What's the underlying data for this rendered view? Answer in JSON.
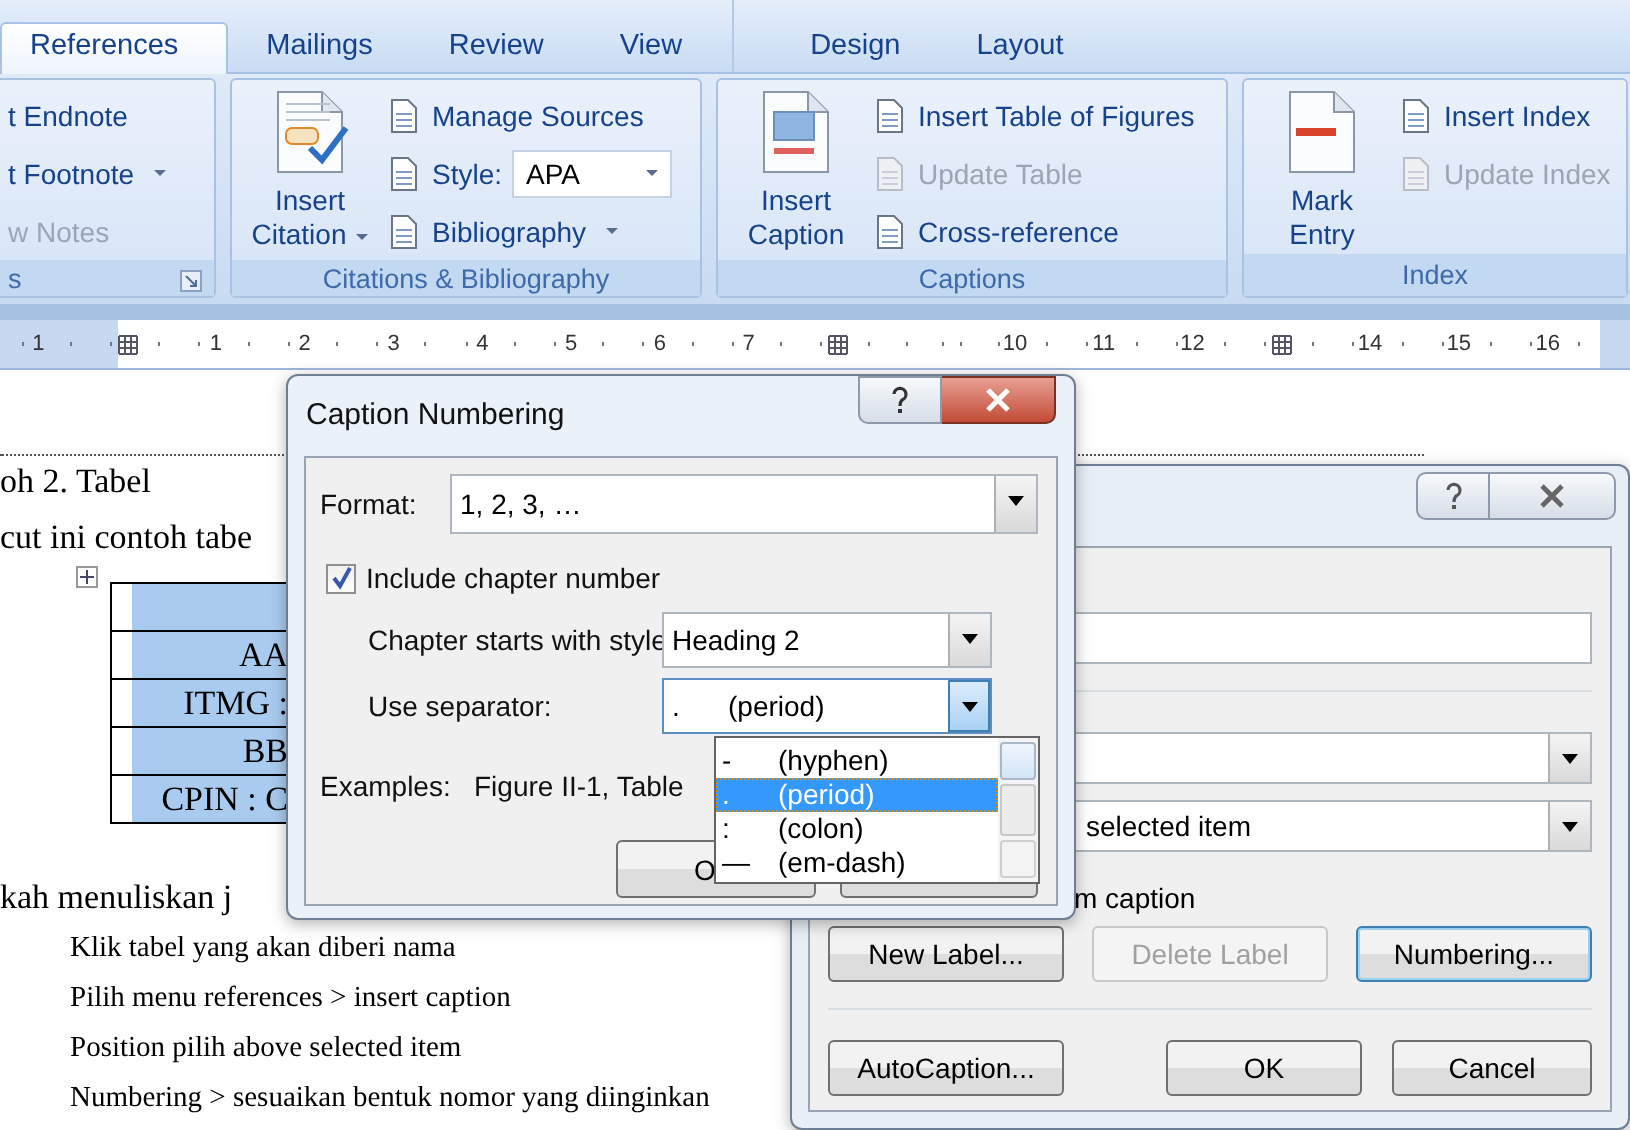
{
  "tabs": [
    {
      "label": "References",
      "selected": true
    },
    {
      "label": "Mailings",
      "selected": false
    },
    {
      "label": "Review",
      "selected": false
    },
    {
      "label": "View",
      "selected": false
    }
  ],
  "contextual_tabs": [
    {
      "label": "Design",
      "selected": false
    },
    {
      "label": "Layout",
      "selected": false
    }
  ],
  "groups": [
    {
      "label": "s",
      "launcher": true,
      "small": [
        {
          "kind": "button",
          "label": "t Endnote",
          "disabled": false,
          "dropdown": false,
          "icon": false
        },
        {
          "kind": "button",
          "label": "t Footnote",
          "disabled": false,
          "dropdown": true,
          "icon": false
        },
        {
          "kind": "button",
          "label": "w Notes",
          "disabled": true,
          "dropdown": false,
          "icon": false
        }
      ]
    },
    {
      "label": "Citations & Bibliography",
      "large": [
        {
          "lines": [
            "Insert",
            "Citation"
          ],
          "dropdown": true
        }
      ],
      "small": [
        {
          "kind": "button",
          "label": "Manage Sources",
          "disabled": false,
          "dropdown": false,
          "icon": true
        },
        {
          "kind": "combo",
          "label": "Style:",
          "value": "APA",
          "icon": true
        },
        {
          "kind": "button",
          "label": "Bibliography",
          "disabled": false,
          "dropdown": true,
          "icon": true
        }
      ]
    },
    {
      "label": "Captions",
      "large": [
        {
          "lines": [
            "Insert",
            "Caption"
          ],
          "dropdown": false
        }
      ],
      "small": [
        {
          "kind": "button",
          "label": "Insert Table of Figures",
          "disabled": false,
          "dropdown": false,
          "icon": true
        },
        {
          "kind": "button",
          "label": "Update Table",
          "disabled": true,
          "dropdown": false,
          "icon": true
        },
        {
          "kind": "button",
          "label": "Cross-reference",
          "disabled": false,
          "dropdown": false,
          "icon": true
        }
      ]
    },
    {
      "label": "Index",
      "large": [
        {
          "lines": [
            "Mark",
            "Entry"
          ],
          "dropdown": false
        }
      ],
      "small": [
        {
          "kind": "button",
          "label": "Insert Index",
          "disabled": false,
          "dropdown": false,
          "icon": true
        },
        {
          "kind": "button",
          "label": "Update Index",
          "disabled": true,
          "dropdown": false,
          "icon": true
        }
      ]
    }
  ],
  "ruler": [
    {
      "kind": "num",
      "label": "1"
    },
    {
      "kind": "marker"
    },
    {
      "kind": "num",
      "label": "1"
    },
    {
      "kind": "num",
      "label": "2"
    },
    {
      "kind": "num",
      "label": "3"
    },
    {
      "kind": "num",
      "label": "4"
    },
    {
      "kind": "num",
      "label": "5"
    },
    {
      "kind": "num",
      "label": "6"
    },
    {
      "kind": "num",
      "label": "7"
    },
    {
      "kind": "marker"
    },
    {
      "kind": "tick"
    },
    {
      "kind": "num",
      "label": "10"
    },
    {
      "kind": "num",
      "label": "11"
    },
    {
      "kind": "num",
      "label": "12"
    },
    {
      "kind": "marker"
    },
    {
      "kind": "num",
      "label": "14"
    },
    {
      "kind": "num",
      "label": "15"
    },
    {
      "kind": "num",
      "label": "16"
    }
  ],
  "document": {
    "heading": "oh 2. Tabel",
    "intro": "cut ini contoh tabe",
    "table_rows": [
      {
        "kind": "blank"
      },
      {
        "kind": "text",
        "text": "AA"
      },
      {
        "kind": "text",
        "text": "ITMG :"
      },
      {
        "kind": "text",
        "text": "BB"
      },
      {
        "kind": "text",
        "text": "CPIN : C"
      }
    ],
    "subheading": "kah menuliskan j",
    "steps": [
      "Klik tabel yang akan diberi nama",
      "Pilih menu references > insert caption",
      "Position pilih above selected item",
      "Numbering > sesuaikan bentuk nomor yang diinginkan"
    ]
  },
  "caption_dialog": {
    "position_value": "selected item",
    "exclude_label": "m caption",
    "buttons": [
      {
        "label": "New Label...",
        "disabled": false,
        "focused": false
      },
      {
        "label": "Delete Label",
        "disabled": true,
        "focused": false
      },
      {
        "label": "Numbering...",
        "disabled": false,
        "focused": true
      },
      {
        "label": "AutoCaption...",
        "disabled": false,
        "focused": false
      },
      {
        "label": "OK",
        "disabled": false,
        "focused": false
      },
      {
        "label": "Cancel",
        "disabled": false,
        "focused": false
      }
    ]
  },
  "caption_numbering": {
    "title": "Caption Numbering",
    "format": {
      "label": "Format:",
      "value": "1, 2, 3, …"
    },
    "include_chapter": {
      "label": "Include chapter number",
      "checked": true
    },
    "chapter_style": {
      "label": "Chapter starts with style",
      "value": "Heading 2"
    },
    "separator": {
      "label": "Use separator:",
      "symbol": ".",
      "name": "(period)",
      "open": true,
      "options": [
        {
          "symbol": "-",
          "name": "(hyphen)",
          "selected": false
        },
        {
          "symbol": ".",
          "name": "(period)",
          "selected": true
        },
        {
          "symbol": ":",
          "name": "(colon)",
          "selected": false
        },
        {
          "symbol": "—",
          "name": "(em-dash)",
          "selected": false
        }
      ]
    },
    "examples": {
      "label": "Examples:",
      "value": "Figure II-1, Table"
    },
    "ok_label": "O"
  }
}
